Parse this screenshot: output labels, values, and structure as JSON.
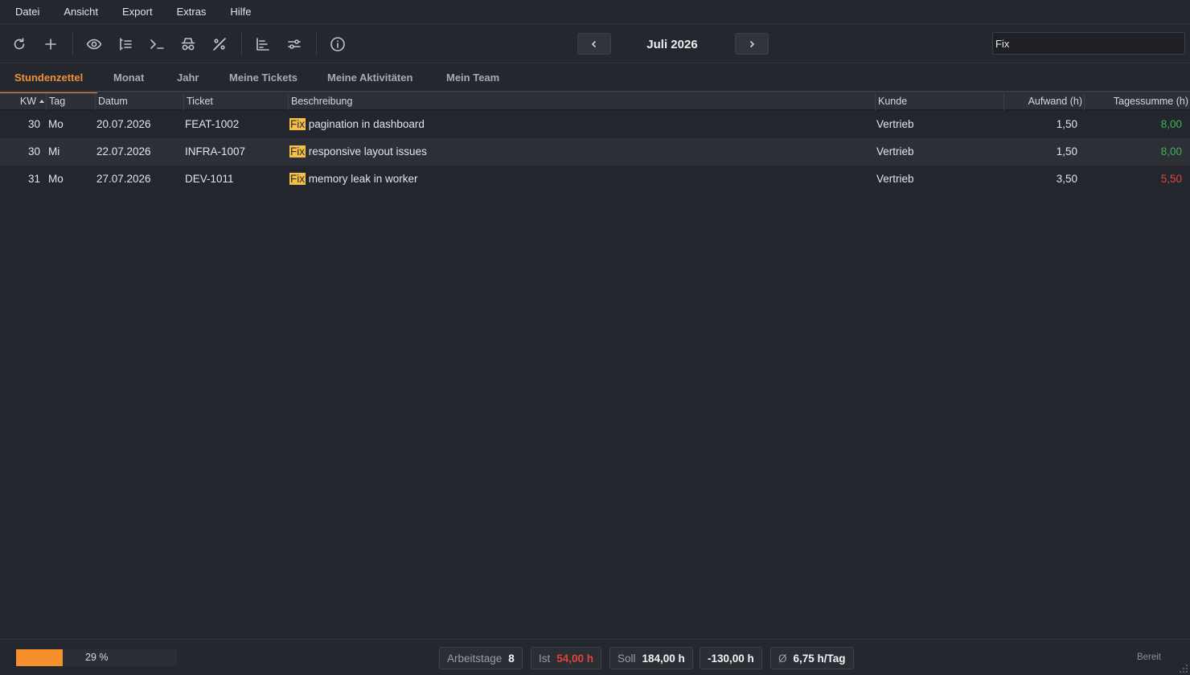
{
  "menu": [
    "Datei",
    "Ansicht",
    "Export",
    "Extras",
    "Hilfe"
  ],
  "toolbar": {
    "month": "Juli 2026",
    "search_value": "Fix",
    "icons": [
      "refresh-icon",
      "plus-icon",
      "eye-icon",
      "list-icon",
      "terminal-icon",
      "spy-icon",
      "percent-icon",
      "chart-icon",
      "sliders-icon",
      "info-icon"
    ]
  },
  "tabs": [
    "Stundenzettel",
    "Monat",
    "Jahr",
    "Meine Tickets",
    "Meine Aktivitäten",
    "Mein Team"
  ],
  "active_tab": "Stundenzettel",
  "columns": [
    "KW",
    "Tag",
    "Datum",
    "Ticket",
    "Beschreibung",
    "Kunde",
    "Aufwand (h)",
    "Tagessumme (h)"
  ],
  "rows": [
    {
      "kw": "30",
      "tag": "Mo",
      "datum": "20.07.2026",
      "ticket": "FEAT-1002",
      "highlight": "Fix",
      "beschreibung": " pagination in dashboard",
      "kunde": "Vertrieb",
      "aufwand": "1,50",
      "tagessumme": "8,00",
      "status": "positive"
    },
    {
      "kw": "30",
      "tag": "Mi",
      "datum": "22.07.2026",
      "ticket": "INFRA-1007",
      "highlight": "Fix",
      "beschreibung": " responsive layout issues",
      "kunde": "Vertrieb",
      "aufwand": "1,50",
      "tagessumme": "8,00",
      "status": "positive"
    },
    {
      "kw": "31",
      "tag": "Mo",
      "datum": "27.07.2026",
      "ticket": "DEV-1011",
      "highlight": "Fix",
      "beschreibung": " memory leak in worker",
      "kunde": "Vertrieb",
      "aufwand": "3,50",
      "tagessumme": "5,50",
      "status": "negative"
    }
  ],
  "status": {
    "progress_percent": 29,
    "progress_label": "29 %",
    "arbeitstage_label": "Arbeitstage",
    "arbeitstage_value": "8",
    "ist_label": "Ist",
    "ist_value": "54,00 h",
    "soll_label": "Soll",
    "soll_value": "184,00 h",
    "diff_value": "-130,00 h",
    "avg_label": "Ø",
    "avg_value": "6,75 h/Tag",
    "ready": "Bereit"
  },
  "colors": {
    "accent": "#f0903a",
    "positive": "#3fb25a",
    "negative": "#e0443e",
    "highlight": "#f5c04a"
  }
}
